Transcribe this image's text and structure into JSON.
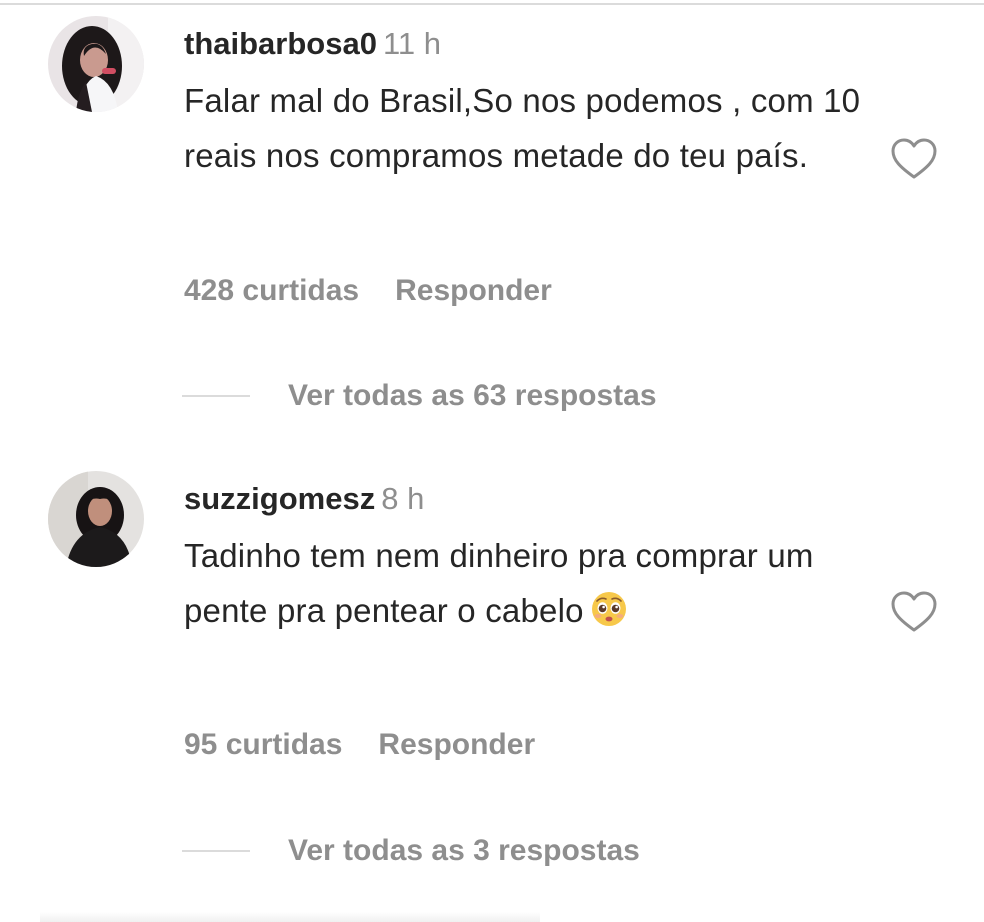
{
  "comments": [
    {
      "username": "thaibarbosa0",
      "time": "11 h",
      "text": "Falar mal do Brasil,So nos podemos , com 10 reais nos compramos metade do teu país.",
      "likes": "428 curtidas",
      "reply_label": "Responder",
      "view_replies": "Ver todas as 63 respostas",
      "emoji": ""
    },
    {
      "username": "suzzigomesz",
      "time": "8 h",
      "text": "Tadinho tem nem dinheiro pra comprar um pente pra pentear o cabelo",
      "likes": "95 curtidas",
      "reply_label": "Responder",
      "view_replies": "Ver todas as 3 respostas",
      "emoji": "pleading-face-emoji"
    }
  ],
  "icons": {
    "like": "heart-outline-icon"
  },
  "colors": {
    "text_primary": "#262626",
    "text_secondary": "#8e8e8e",
    "divider": "#dbdbdb"
  }
}
